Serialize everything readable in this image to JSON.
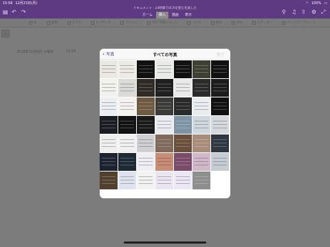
{
  "status": {
    "time": "15:56",
    "date": "12月23日(月)",
    "battery": "100%"
  },
  "document_title": "ドキュメント - 24時間でOCRを使えを試した",
  "tabs": [
    {
      "label": "ホーム",
      "active": false
    },
    {
      "label": "挿入",
      "active": true
    },
    {
      "label": "描画",
      "active": false
    },
    {
      "label": "表示",
      "active": false
    }
  ],
  "ribbon": [
    {
      "label": "表",
      "icon": "table-icon"
    },
    {
      "label": "画像",
      "icon": "image-icon"
    },
    {
      "label": "カメラ",
      "icon": "camera-icon"
    },
    {
      "label": "オーディオ",
      "icon": "microphone-icon"
    },
    {
      "label": "ファイル",
      "icon": "file-icon"
    },
    {
      "label": "PDF 印刷イメージ",
      "icon": "pdf-icon"
    },
    {
      "label": "リンク",
      "icon": "link-icon"
    },
    {
      "label": "数式",
      "icon": "equation-icon"
    },
    {
      "label": "日付",
      "icon": "calendar-icon"
    },
    {
      "label": "ステッカー",
      "icon": "sticker-icon"
    },
    {
      "label": "ページ テンプレート",
      "icon": "template-icon"
    }
  ],
  "page": {
    "date": "2018年12月4日 火曜日",
    "time": "11:56"
  },
  "picker": {
    "back_label": "写真",
    "title": "すべての写真",
    "done_label": "完了"
  },
  "thumbnails": [
    "#e9e9e2",
    "#ecebe6",
    "#111111",
    "#e9ece6",
    "#121212",
    "#3d4033",
    "#111111",
    "#f2f1ec",
    "#dadad6",
    "#2f2a24",
    "#1f1f1f",
    "#e9e9e9",
    "#2b2b2b",
    "#1c1c1c",
    "#eceff2",
    "#f3f2ee",
    "#6e5a40",
    "#3b3b38",
    "#2a2a2a",
    "#e9edf2",
    "#111111",
    "#1a1e24",
    "#111111",
    "#191919",
    "#e8ebef",
    "#7f93a6",
    "#cfd7df",
    "#d5d9de",
    "#eeeeee",
    "#f0f0f0",
    "#cfcfd3",
    "#7f6a5b",
    "#6a4f3d",
    "#a88d7b",
    "#2f3842",
    "#1b2230",
    "#1d2a35",
    "#f0eef5",
    "#c88d74",
    "#7a4b6b",
    "#d0b8c8",
    "#c6ccd3",
    "#52402f",
    "#dfe3ef",
    "#f2f2f2",
    "#e9e6f2",
    "#ece7f4",
    "#8e8e8e"
  ],
  "colors": {
    "accent": "#5d3a82",
    "backdrop": "#7e7e7e"
  }
}
